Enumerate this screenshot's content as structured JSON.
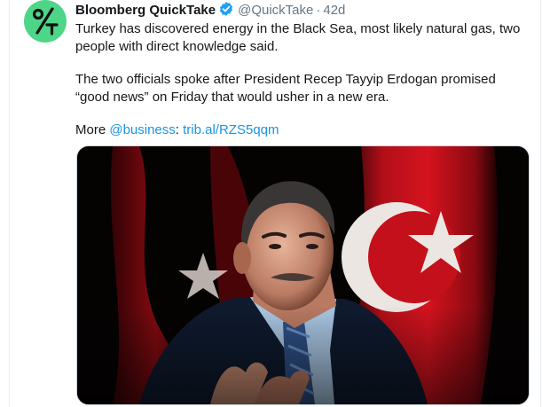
{
  "tweet": {
    "author_name": "Bloomberg QuickTake",
    "handle": "@QuickTake",
    "separator": "·",
    "time": "42d",
    "paragraph1": "Turkey has discovered energy in the Black Sea, most likely natural gas, two people with direct knowledge said.",
    "paragraph2": "The two officials spoke after President Recep Tayyip Erdogan promised “good news” on Friday that would usher in a new era.",
    "more_prefix": "More ",
    "mention": "@business",
    "colon": ":",
    "short_link": "trib.al/RZS5qqm"
  },
  "icons": {
    "avatar": "bloomberg-quicktake-logo",
    "verified": "verified-badge-icon"
  },
  "colors": {
    "avatar_bg": "#4dd688",
    "link": "#1b95e0",
    "secondary_text": "#657786",
    "flag_red": "#c4101a"
  }
}
